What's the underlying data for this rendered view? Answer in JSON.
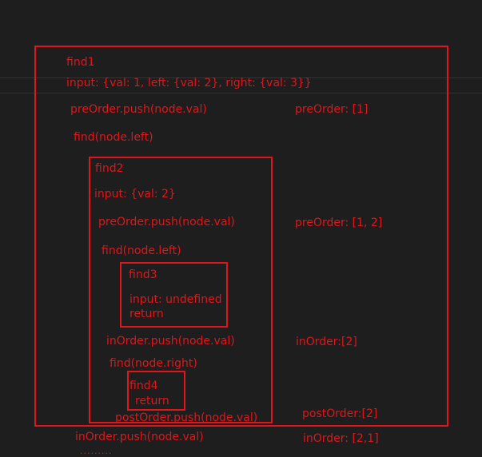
{
  "colors": {
    "background": "#1e1e1e",
    "stroke": "#e0161a",
    "guide_line": "#333333"
  },
  "find1": {
    "title": "find1",
    "input": "input: {val: 1, left: {val: 2}, right: {val: 3}}",
    "pre_push": "preOrder.push(node.val)",
    "find_left": "find(node.left)",
    "in_push": "inOrder.push(node.val)",
    "ellipsis": "........."
  },
  "find2": {
    "title": "find2",
    "input": "input: {val: 2}",
    "pre_push": "preOrder.push(node.val)",
    "find_left": "find(node.left)",
    "in_push": "inOrder.push(node.val)",
    "find_right": "find(node.right)",
    "post_push": "postOrder.push(node.val)"
  },
  "find3": {
    "title": "find3",
    "input": "input: undefined",
    "ret": "return"
  },
  "find4": {
    "title": "find4",
    "ret": "return"
  },
  "state": {
    "pre1": "preOrder: [1]",
    "pre2": "preOrder: [1, 2]",
    "in1": "inOrder:[2]",
    "post1": "postOrder:[2]",
    "in2": "inOrder: [2,1]"
  }
}
